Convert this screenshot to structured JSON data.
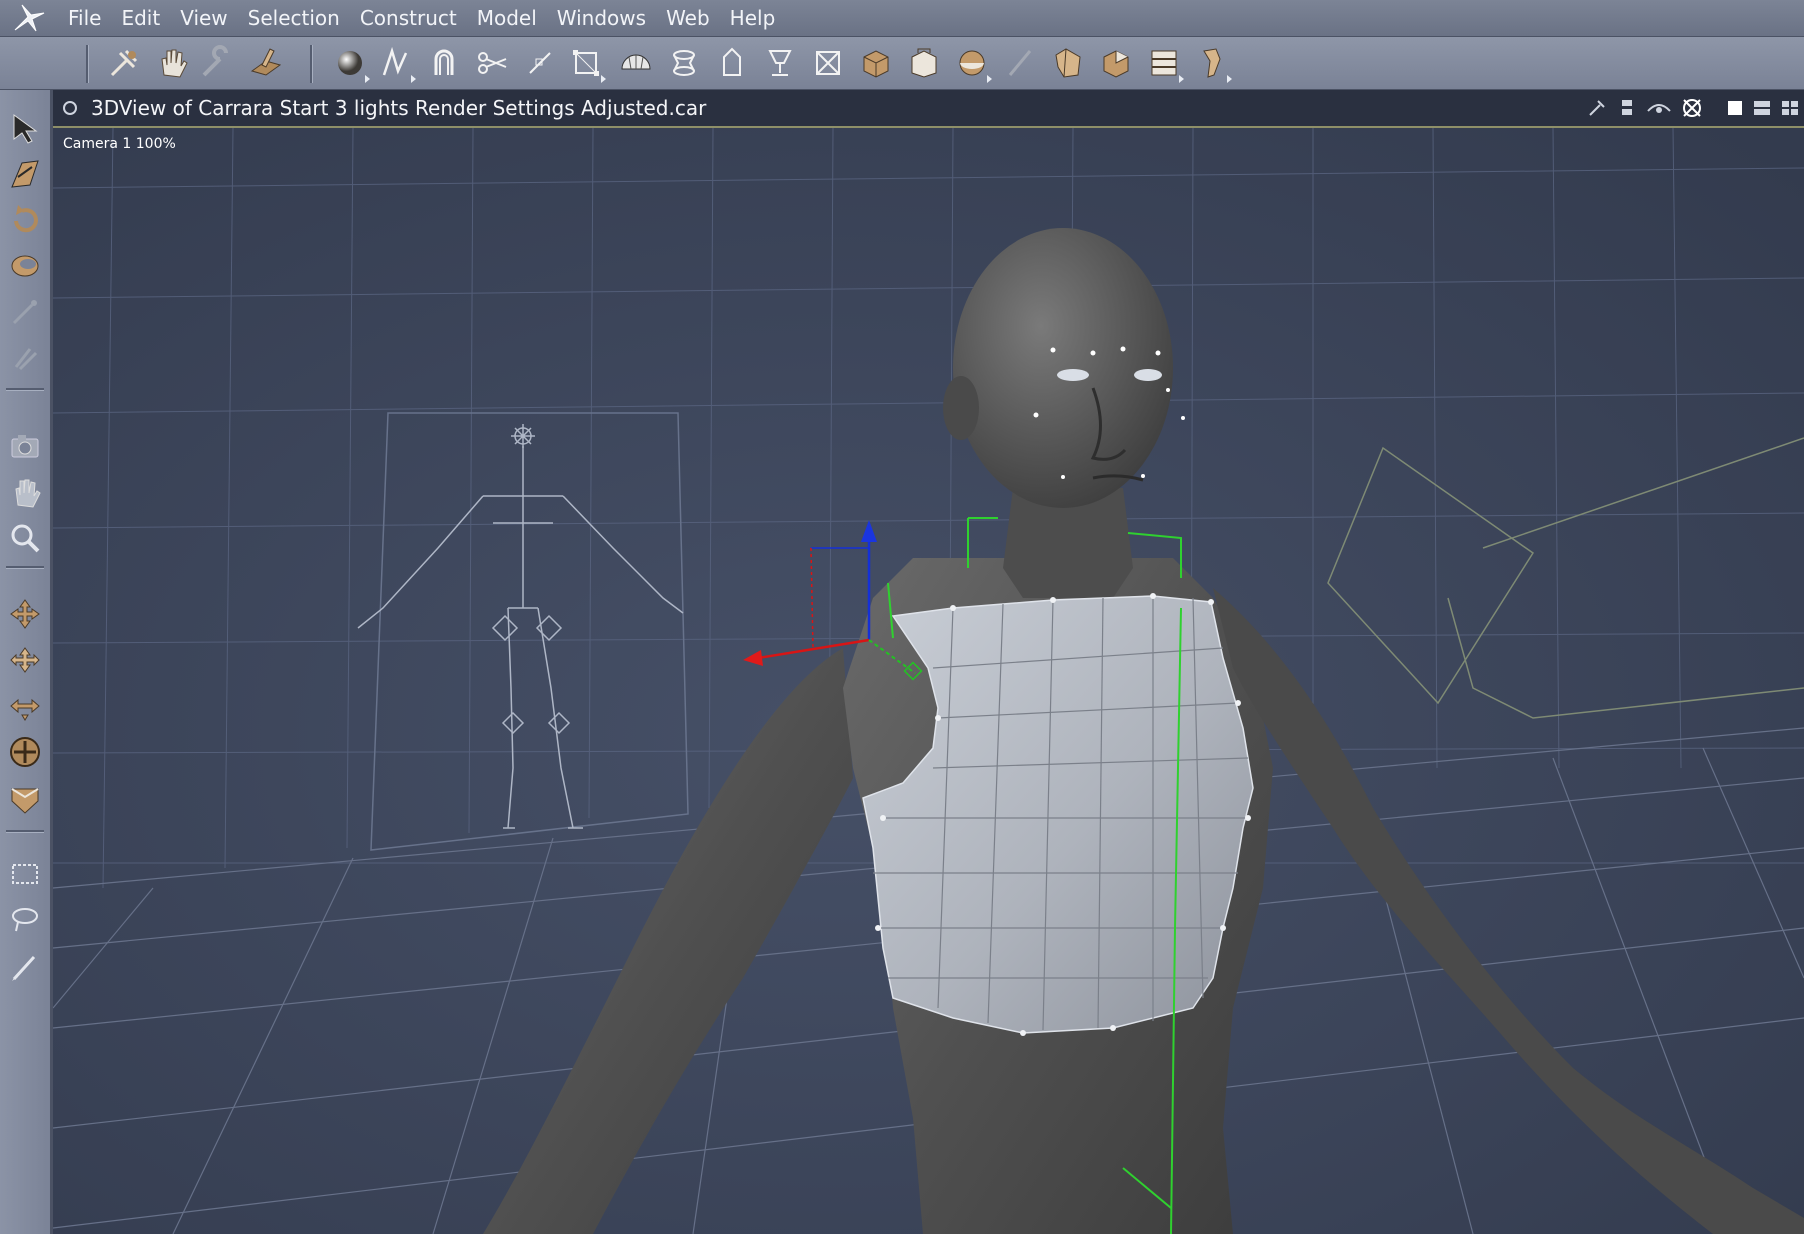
{
  "menu": {
    "items": [
      "File",
      "Edit",
      "View",
      "Selection",
      "Construct",
      "Model",
      "Windows",
      "Web",
      "Help"
    ]
  },
  "toolbar": {
    "groups": [
      [
        "select-tool-icon",
        "hand-tool-icon",
        "wrench-tool-icon",
        "move-tool-icon"
      ],
      [
        "sphere-primitive-icon",
        "spline-icon",
        "magnet-icon",
        "scissors-icon",
        "line-icon",
        "box-frame-icon",
        "dome-icon",
        "lathe-icon",
        "extrude-icon",
        "goblet-icon",
        "crossbox-icon",
        "cube-icon",
        "bag-icon",
        "ball-icon",
        "pencil-icon",
        "figure-icon",
        "box-open-icon",
        "ladder-icon",
        "bone-icon"
      ]
    ]
  },
  "left_palette": {
    "tools": [
      "arrow-select-icon",
      "direct-select-icon",
      "rotate-icon",
      "twist-icon",
      "disabled-pin-icon",
      "disabled-link-icon",
      "camera-icon",
      "pan-hand-icon",
      "zoom-icon",
      "move-xy-icon",
      "move-xz-icon",
      "move-yz-icon",
      "trackball-icon",
      "plane-icon",
      "marquee-icon",
      "lasso-icon",
      "brush-icon"
    ]
  },
  "view": {
    "title": "3DView of Carrara Start 3 lights Render Settings Adjusted.car",
    "camera_label": "Camera 1 100%",
    "header_icons": [
      "eyedropper-icon",
      "stack-icon",
      "eye-icon",
      "settings-icon",
      "single-view-icon",
      "dual-view-icon",
      "quad-view-icon"
    ]
  },
  "colors": {
    "menubar": "#747c8f",
    "toolbar": "#848c9f",
    "viewport_bg": "#3a4458",
    "grid": "#58627a",
    "titlebar": "#2a3040",
    "tool_bronze": "#b08a5c"
  }
}
